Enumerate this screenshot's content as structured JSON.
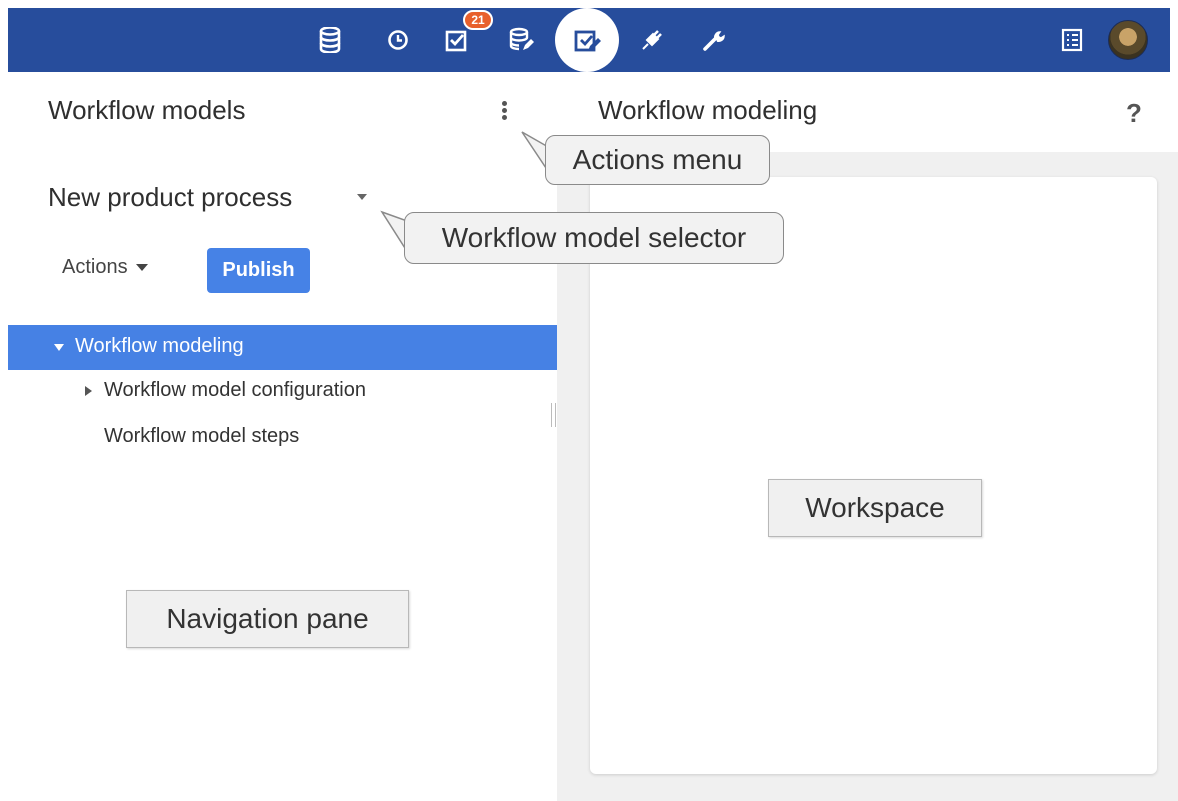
{
  "topbar": {
    "badge_count": "21",
    "icons": [
      "database-icon",
      "clock-icon",
      "tasks-icon",
      "data-edit-icon",
      "workflow-icon",
      "plug-icon",
      "wrench-icon",
      "list-icon",
      "avatar"
    ]
  },
  "left_pane": {
    "title": "Workflow models",
    "selector_value": "New product process",
    "actions_label": "Actions",
    "publish_label": "Publish",
    "tree": [
      {
        "label": "Workflow modeling"
      },
      {
        "label": "Workflow model configuration"
      },
      {
        "label": "Workflow model steps"
      }
    ]
  },
  "right_pane": {
    "title": "Workflow modeling",
    "help_label": "?"
  },
  "callouts": {
    "actions_menu": "Actions menu",
    "model_selector": "Workflow model selector",
    "workspace": "Workspace",
    "navigation_pane": "Navigation pane"
  },
  "colors": {
    "topbar": "#274d9c",
    "selected_row": "#4681e4",
    "publish": "#4682e6",
    "badge": "#e8602c"
  }
}
